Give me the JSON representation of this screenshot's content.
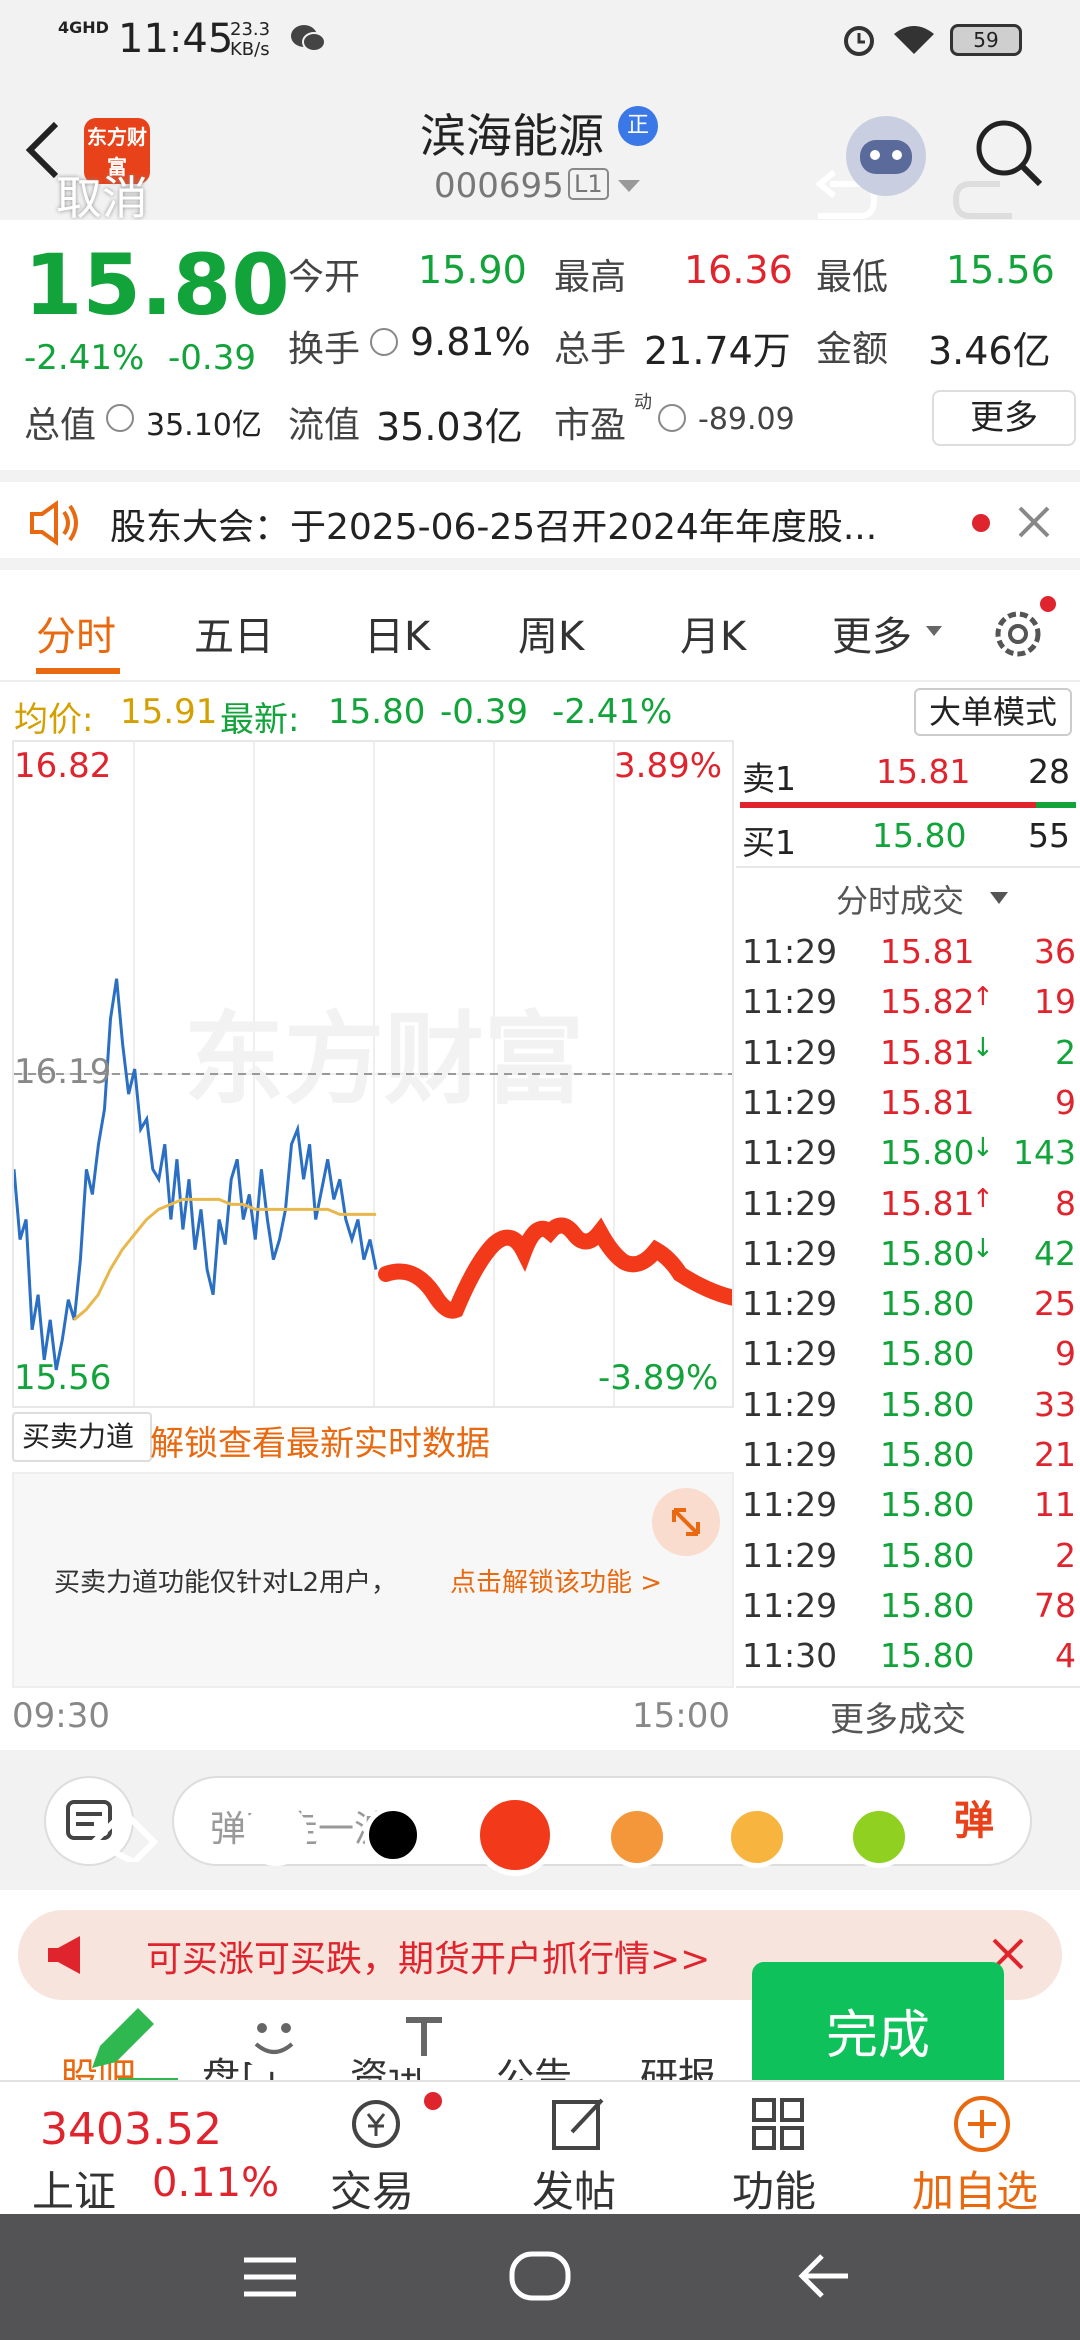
{
  "status": {
    "network": "4GHD",
    "time": "11:45",
    "speed": "23.3",
    "speed_unit": "KB/s",
    "battery": "59"
  },
  "header": {
    "title": "滨海能源",
    "code": "000695",
    "level": "L1",
    "badge": "正",
    "logo_text": "东方财富",
    "cancel_label": "取消"
  },
  "quote": {
    "price": "15.80",
    "change_pct": "-2.41%",
    "change": "-0.39",
    "fields": [
      {
        "label": "今开",
        "value": "15.90"
      },
      {
        "label": "最高",
        "value": "16.36"
      },
      {
        "label": "最低",
        "value": "15.56"
      },
      {
        "label": "换手",
        "value": "9.81%"
      },
      {
        "label": "总手",
        "value": "21.74万"
      },
      {
        "label": "金额",
        "value": "3.46亿"
      },
      {
        "label": "总值",
        "value": "35.10亿"
      },
      {
        "label": "流值",
        "value": "35.03亿"
      },
      {
        "label": "市盈",
        "value": "-89.09",
        "sup": "动"
      }
    ],
    "more_label": "更多"
  },
  "notice": {
    "text": "股东大会：于2025-06-25召开2024年年度股..."
  },
  "tabs": {
    "items": [
      "分时",
      "五日",
      "日K",
      "周K",
      "月K",
      "更多"
    ],
    "active": 0
  },
  "info": {
    "avg_label": "均价:",
    "avg": "15.91",
    "latest_label": "最新:",
    "latest": "15.80",
    "change": "-0.39",
    "change_pct": "-2.41%",
    "mode_button": "大单模式"
  },
  "chart_data": {
    "type": "line",
    "ylim": [
      15.56,
      16.82
    ],
    "y_top_label": "16.82",
    "y_bottom_label": "15.56",
    "pct_top_label": "3.89%",
    "pct_bottom_label": "-3.89%",
    "ref_line_label": "16.19",
    "x_start_label": "09:30",
    "x_end_label": "15:00",
    "watermark": "东方财富",
    "series": [
      {
        "values": [
          16.0,
          15.86,
          15.9,
          15.68,
          15.75,
          15.62,
          15.7,
          15.6,
          15.66,
          15.74,
          15.7,
          15.82,
          16.0,
          15.95,
          16.05,
          16.12,
          16.3,
          16.38,
          16.25,
          16.15,
          16.2,
          16.08,
          16.1,
          16.0,
          15.98,
          16.05,
          15.9,
          16.02,
          15.88,
          15.98,
          15.84,
          15.92,
          15.8,
          15.75,
          15.9,
          15.85,
          15.98,
          16.02,
          15.9,
          15.95,
          15.86,
          16.0,
          15.9,
          15.82,
          15.86,
          15.92,
          16.05,
          16.08,
          15.98,
          16.05,
          15.9,
          15.96,
          16.02,
          15.94,
          15.98,
          15.9,
          15.86,
          15.9,
          15.82,
          15.86,
          15.8
        ]
      },
      {
        "values": [
          15.7,
          15.72,
          15.75,
          15.8,
          15.84,
          15.87,
          15.9,
          15.92,
          15.93,
          15.94,
          15.94,
          15.94,
          15.94,
          15.93,
          15.93,
          15.92,
          15.92,
          15.92,
          15.92,
          15.92,
          15.92,
          15.92,
          15.91,
          15.91,
          15.91,
          15.91
        ]
      }
    ]
  },
  "book": {
    "sell": {
      "label": "卖1",
      "price": "15.81",
      "vol": "28"
    },
    "buy": {
      "label": "买1",
      "price": "15.80",
      "vol": "55"
    },
    "trades_title": "分时成交",
    "trades": [
      {
        "t": "11:29",
        "p": "15.81",
        "v": "36",
        "arrow": ""
      },
      {
        "t": "11:29",
        "p": "15.82",
        "v": "19",
        "arrow": "↑"
      },
      {
        "t": "11:29",
        "p": "15.81",
        "v": "2",
        "arrow": "↓"
      },
      {
        "t": "11:29",
        "p": "15.81",
        "v": "9",
        "arrow": ""
      },
      {
        "t": "11:29",
        "p": "15.80",
        "v": "143",
        "arrow": "↓"
      },
      {
        "t": "11:29",
        "p": "15.81",
        "v": "8",
        "arrow": "↑"
      },
      {
        "t": "11:29",
        "p": "15.80",
        "v": "42",
        "arrow": "↓"
      },
      {
        "t": "11:29",
        "p": "15.80",
        "v": "25",
        "arrow": ""
      },
      {
        "t": "11:29",
        "p": "15.80",
        "v": "9",
        "arrow": ""
      },
      {
        "t": "11:29",
        "p": "15.80",
        "v": "33",
        "arrow": ""
      },
      {
        "t": "11:29",
        "p": "15.80",
        "v": "21",
        "arrow": ""
      },
      {
        "t": "11:29",
        "p": "15.80",
        "v": "11",
        "arrow": ""
      },
      {
        "t": "11:29",
        "p": "15.80",
        "v": "2",
        "arrow": ""
      },
      {
        "t": "11:29",
        "p": "15.80",
        "v": "78",
        "arrow": ""
      },
      {
        "t": "11:30",
        "p": "15.80",
        "v": "4",
        "arrow": ""
      }
    ],
    "more_trades": "更多成交"
  },
  "lock": {
    "dropdown": "买卖力道",
    "link": "解锁查看最新实时数据",
    "text": "买卖力道功能仅针对L2用户，",
    "unlock": "点击解锁该功能 >"
  },
  "editor": {
    "comment_placeholder": "弹幕走一波",
    "colors": [
      "#ffffff",
      "#000000",
      "#f23a1a",
      "#f4973a",
      "#f7b43f",
      "#8fd020"
    ],
    "done_label": "完成"
  },
  "ad": {
    "text": "可买涨可买跌，期货开户抓行情>>"
  },
  "bottom_tabs": [
    "股吧",
    "盘口",
    "资讯",
    "公告",
    "研报"
  ],
  "bottom": {
    "index_value": "3403.52",
    "index_name": "上证",
    "index_change": "0.11%",
    "trade": "交易",
    "post": "发帖",
    "func": "功能",
    "add": "加自选"
  }
}
